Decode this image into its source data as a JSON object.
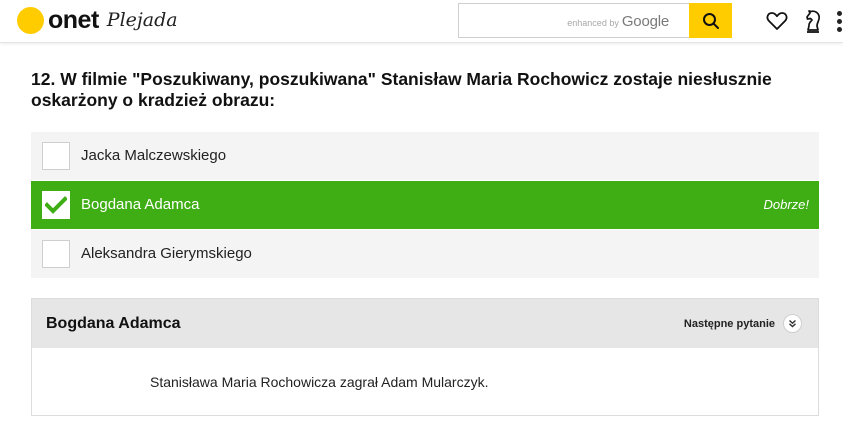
{
  "header": {
    "logo_text": "onet",
    "logo_subtitle": "Plejada",
    "search": {
      "value": "",
      "placeholder": "",
      "enhanced_by": "enhanced by",
      "provider": "Google"
    }
  },
  "icons": {
    "search": "search-icon",
    "favorites": "heart-icon",
    "games": "chess-knight-icon",
    "more": "more-icon",
    "check": "checkmark-icon",
    "next": "chevron-down-icon"
  },
  "colors": {
    "brand_yellow": "#ffcc00",
    "correct_green": "#3fae15",
    "answer_bg": "#f4f4f4",
    "panel_header_bg": "#e6e6e6"
  },
  "quiz": {
    "question": "12. W filmie \"Poszukiwany, poszukiwana\" Stanisław Maria Rochowicz zostaje niesłusznie oskarżony o kradzież obrazu:",
    "answers": [
      {
        "label": "Jacka Malczewskiego",
        "selected": false
      },
      {
        "label": "Bogdana Adamca",
        "selected": true,
        "verdict": "Dobrze!"
      },
      {
        "label": "Aleksandra Gierymskiego",
        "selected": false
      }
    ],
    "result": {
      "title": "Bogdana Adamca",
      "next_label": "Następne pytanie",
      "explanation": "Stanisława Maria Rochowicza zagrał Adam Mularczyk."
    }
  }
}
